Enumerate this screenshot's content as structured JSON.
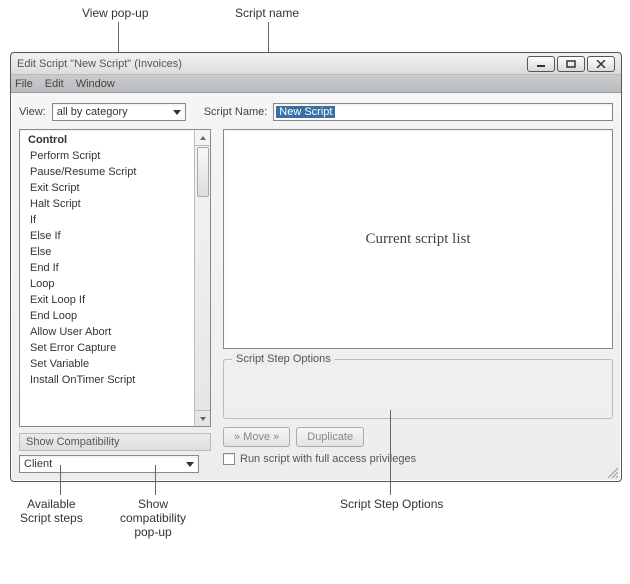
{
  "window_title": "Edit Script \"New Script\" (Invoices)",
  "menu": {
    "file": "File",
    "edit": "Edit",
    "window": "Window"
  },
  "view_label": "View:",
  "view_value": "all by category",
  "script_name_label": "Script Name:",
  "script_name_value": "New Script",
  "steps_header": "Control",
  "steps": [
    "Perform Script",
    "Pause/Resume Script",
    "Exit Script",
    "Halt Script",
    "If",
    "Else If",
    "Else",
    "End If",
    "Loop",
    "Exit Loop If",
    "End Loop",
    "Allow User Abort",
    "Set Error Capture",
    "Set Variable",
    "Install OnTimer Script"
  ],
  "show_compat_label": "Show Compatibility",
  "compat_value": "Client",
  "script_area_placeholder": "Current script list",
  "options_legend": "Script Step Options",
  "move_btn": "» Move »",
  "duplicate_btn": "Duplicate",
  "full_access_label": "Run script with full access privileges",
  "callouts": {
    "view_popup": "View pop-up",
    "script_name": "Script name",
    "available_steps": "Available\nScript steps",
    "show_compat_popup": "Show\ncompatibility\npop-up",
    "script_step_options": "Script Step Options",
    "inline_options": "Script Step Options"
  }
}
